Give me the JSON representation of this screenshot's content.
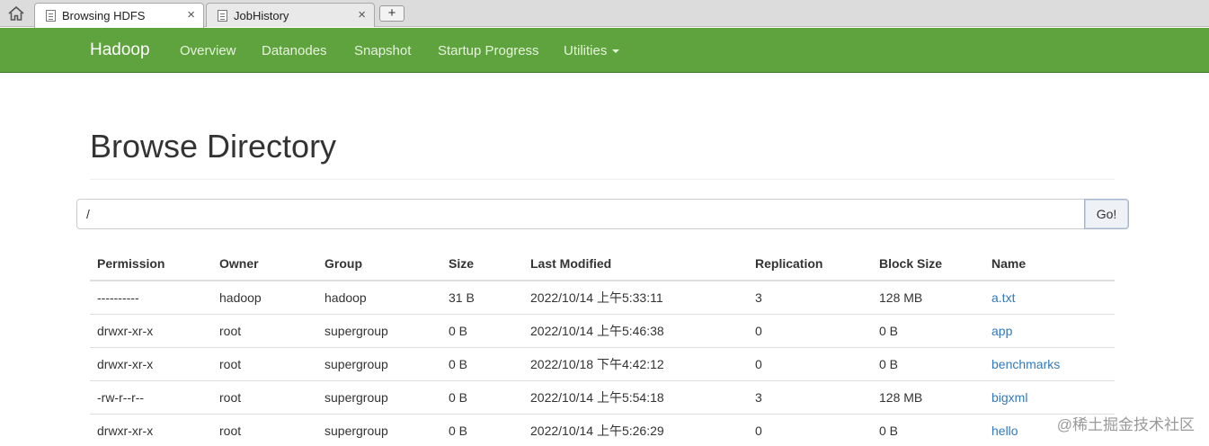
{
  "browser": {
    "tabs": [
      {
        "label": "Browsing HDFS",
        "active": true,
        "close": "×"
      },
      {
        "label": "JobHistory",
        "active": false,
        "close": "×"
      }
    ],
    "new_tab": "+"
  },
  "navbar": {
    "brand": "Hadoop",
    "items": [
      "Overview",
      "Datanodes",
      "Snapshot",
      "Startup Progress",
      "Utilities"
    ],
    "color": "#5fa33e"
  },
  "page": {
    "title": "Browse Directory",
    "path_value": "/",
    "go_label": "Go!"
  },
  "table": {
    "headers": [
      "Permission",
      "Owner",
      "Group",
      "Size",
      "Last Modified",
      "Replication",
      "Block Size",
      "Name"
    ],
    "rows": [
      [
        "----------",
        "hadoop",
        "hadoop",
        "31 B",
        "2022/10/14 上午5:33:11",
        "3",
        "128 MB",
        "a.txt"
      ],
      [
        "drwxr-xr-x",
        "root",
        "supergroup",
        "0 B",
        "2022/10/14 上午5:46:38",
        "0",
        "0 B",
        "app"
      ],
      [
        "drwxr-xr-x",
        "root",
        "supergroup",
        "0 B",
        "2022/10/18 下午4:42:12",
        "0",
        "0 B",
        "benchmarks"
      ],
      [
        "-rw-r--r--",
        "root",
        "supergroup",
        "0 B",
        "2022/10/14 上午5:54:18",
        "3",
        "128 MB",
        "bigxml"
      ],
      [
        "drwxr-xr-x",
        "root",
        "supergroup",
        "0 B",
        "2022/10/14 上午5:26:29",
        "0",
        "0 B",
        "hello"
      ]
    ]
  },
  "watermark": "@稀土掘金技术社区"
}
